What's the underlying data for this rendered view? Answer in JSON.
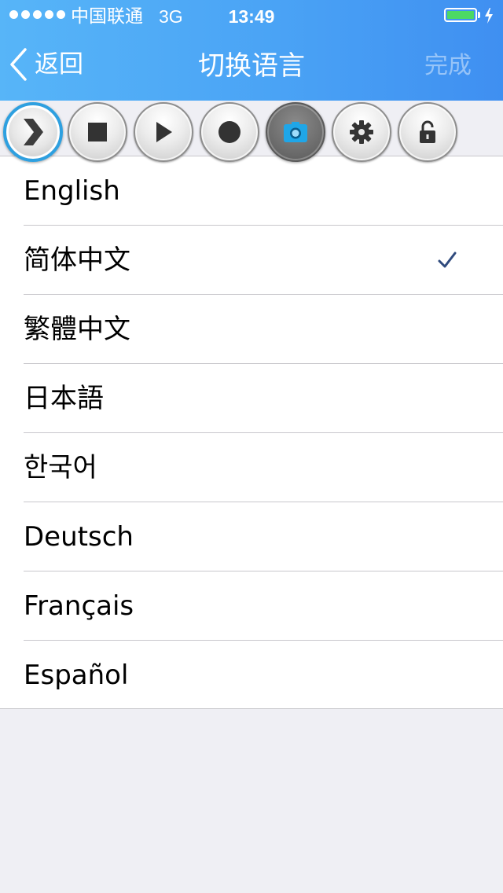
{
  "status_bar": {
    "carrier": "中国联通",
    "network": "3G",
    "time": "13:49",
    "signal_bars": 5,
    "battery_level": 1.0,
    "charging": true
  },
  "nav": {
    "back_label": "返回",
    "title": "切换语言",
    "done_label": "完成"
  },
  "toolbar": {
    "buttons": [
      {
        "name": "expand",
        "icon": "chevron-right-icon",
        "state": "highlighted"
      },
      {
        "name": "stop",
        "icon": "stop-icon"
      },
      {
        "name": "play",
        "icon": "play-icon"
      },
      {
        "name": "record",
        "icon": "record-icon"
      },
      {
        "name": "screenshot",
        "icon": "camera-icon",
        "state": "active"
      },
      {
        "name": "settings",
        "icon": "gear-icon"
      },
      {
        "name": "lock",
        "icon": "unlock-icon"
      }
    ]
  },
  "languages": {
    "items": [
      {
        "label": "English",
        "selected": false
      },
      {
        "label": "简体中文",
        "selected": true
      },
      {
        "label": "繁體中文",
        "selected": false
      },
      {
        "label": "日本語",
        "selected": false
      },
      {
        "label": "한국어",
        "selected": false
      },
      {
        "label": "Deutsch",
        "selected": false
      },
      {
        "label": "Français",
        "selected": false
      },
      {
        "label": "Español",
        "selected": false
      }
    ]
  },
  "colors": {
    "nav_gradient_start": "#57b5f8",
    "nav_gradient_end": "#3f8ff1",
    "checkmark": "#2f4a7d",
    "battery": "#4cd964",
    "expand_ring": "#2ea0e0",
    "camera": "#1fa6e8",
    "background": "#efeff4"
  }
}
